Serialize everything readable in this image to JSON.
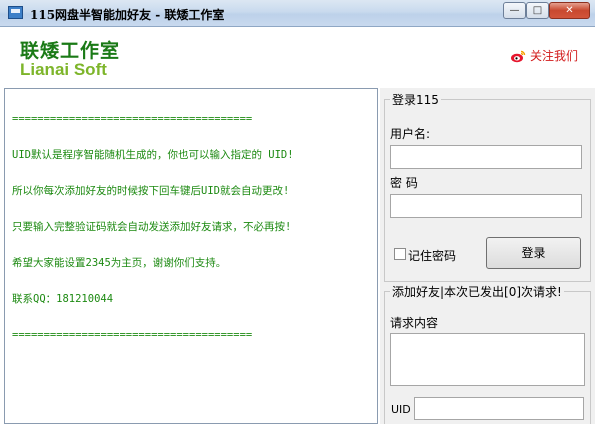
{
  "window": {
    "title": "115网盘半智能加好友 - 联矮工作室",
    "minimize_glyph": "—",
    "maximize_glyph": "□",
    "close_glyph": "✕"
  },
  "header": {
    "logo_cn": "联矮工作室",
    "logo_en": "Lianai Soft",
    "follow_label": "关注我们",
    "follow_icon": "weibo-icon",
    "follow_color": "#d21a1a"
  },
  "log": {
    "lines": [
      "======================================",
      "UID默认是程序智能随机生成的，你也可以输入指定的 UID!",
      "所以你每次添加好友的时候按下回车键后UID就会自动更改!",
      "只要输入完整验证码就会自动发送添加好友请求，不必再按!",
      "希望大家能设置2345为主页，谢谢你们支持。",
      "联系QQ：181210044",
      "======================================"
    ],
    "text_color": "#1d8a12"
  },
  "login": {
    "group_title": "登录115",
    "username_label": "用户名:",
    "username_value": "",
    "password_label": "密  码",
    "password_value": "",
    "remember_label": "记住密码",
    "remember_checked": false,
    "login_button": "登录"
  },
  "add_friend": {
    "group_title": "添加好友|本次已发出[0]次请求!",
    "request_label": "请求内容",
    "request_value": "",
    "uid_label": "UID",
    "uid_value": ""
  }
}
